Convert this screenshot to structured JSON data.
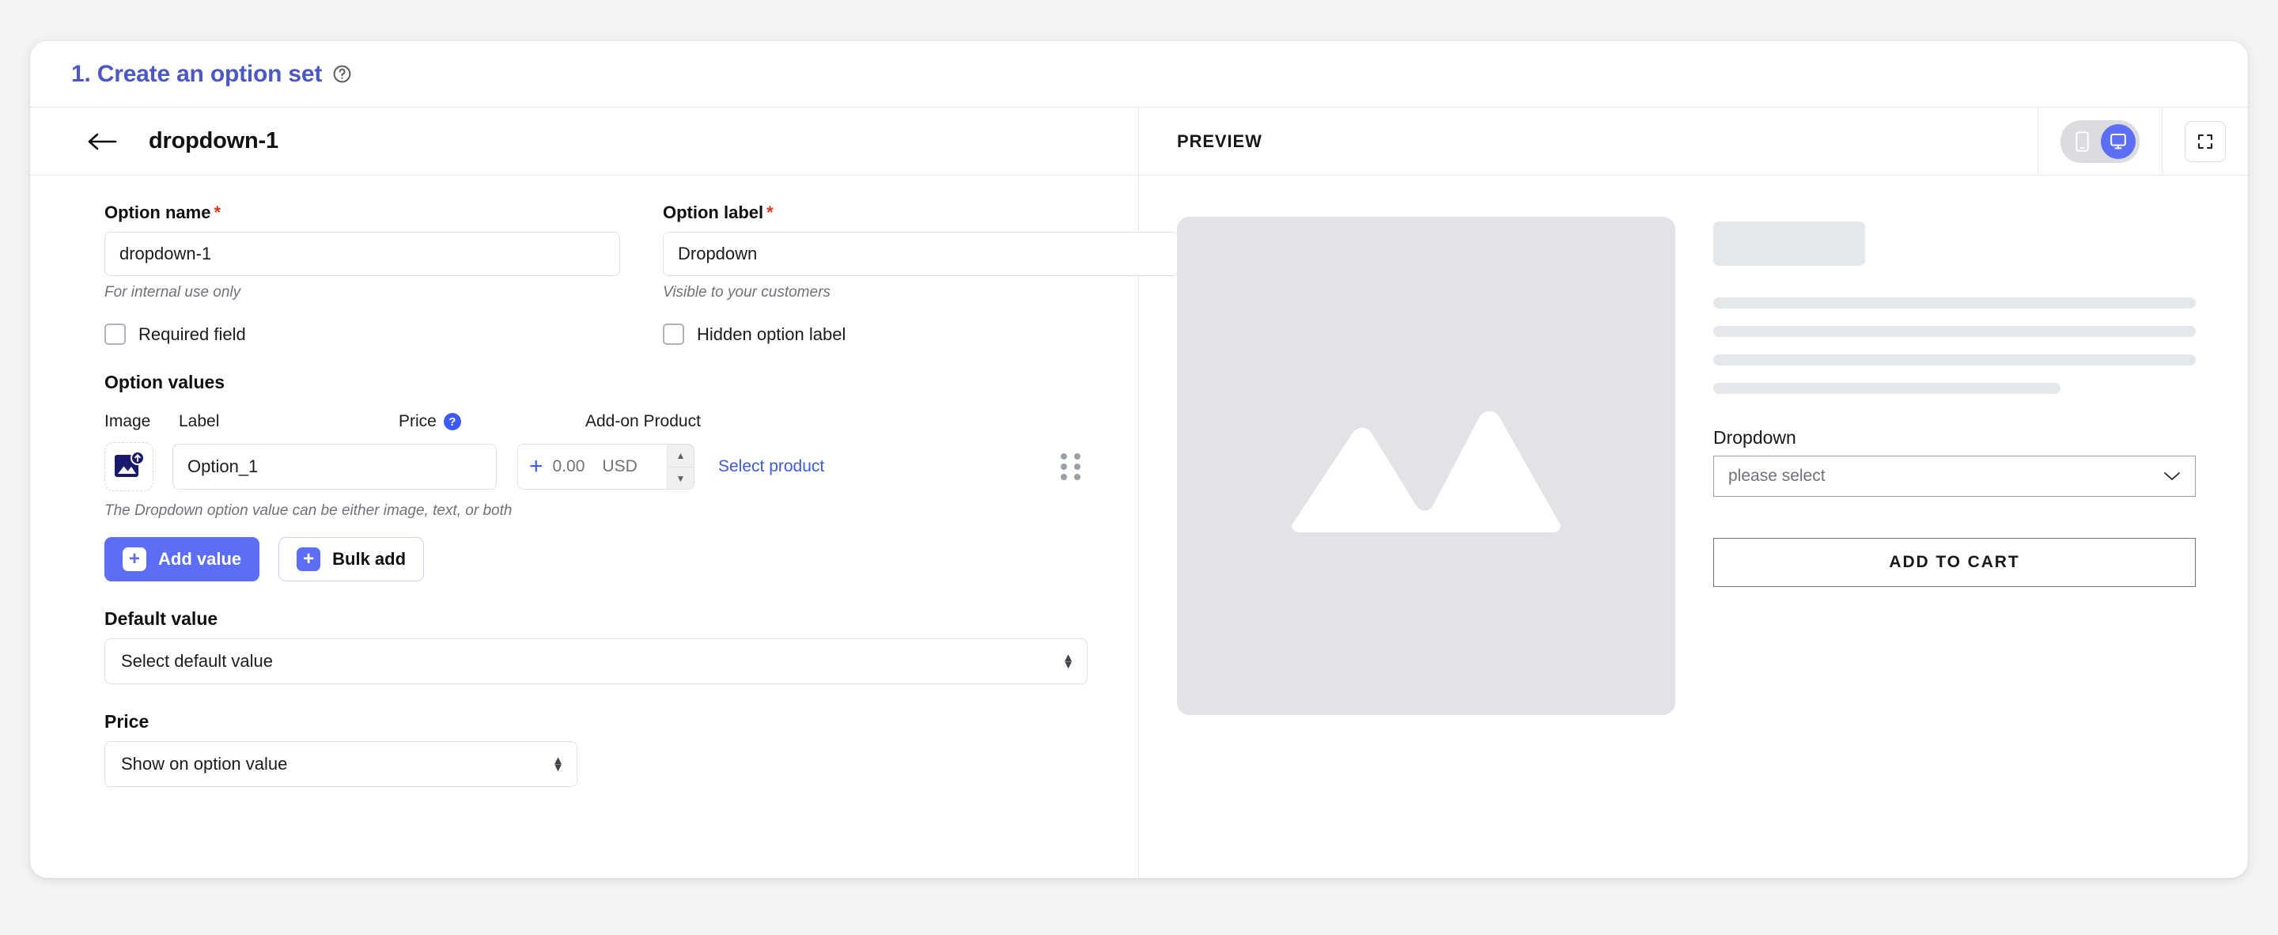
{
  "card": {
    "header_title": "1. Create an option set",
    "help_icon": "help-circle-icon"
  },
  "left": {
    "back_icon": "arrow-left-icon",
    "title": "dropdown-1",
    "option_name": {
      "label": "Option name",
      "required_mark": "*",
      "value": "dropdown-1",
      "hint": "For internal use only"
    },
    "option_label": {
      "label": "Option label",
      "required_mark": "*",
      "value": "Dropdown",
      "hint": "Visible to your customers"
    },
    "checkboxes": [
      {
        "label": "Required field",
        "checked": false
      },
      {
        "label": "Hidden option label",
        "checked": false
      }
    ],
    "option_values": {
      "section_title": "Option values",
      "columns": {
        "image": "Image",
        "label": "Label",
        "price": "Price",
        "price_help_icon": "question-badge-icon",
        "addon": "Add-on Product"
      },
      "rows": [
        {
          "image_icon": "image-upload-icon",
          "label_value": "Option_1",
          "price_plus": "+",
          "price_value": "0.00",
          "currency": "USD",
          "addon_link": "Select product",
          "drag_icon": "drag-handle-icon"
        }
      ],
      "hint": "The Dropdown option value can be either image, text, or both"
    },
    "buttons": {
      "add_value": "Add value",
      "bulk_add": "Bulk add",
      "plus_glyph": "+"
    },
    "default_value": {
      "label": "Default value",
      "selected": "Select default value"
    },
    "price_display": {
      "label": "Price",
      "selected": "Show on option value"
    }
  },
  "preview": {
    "title": "PREVIEW",
    "device_toggle": {
      "mobile_icon": "mobile-icon",
      "desktop_icon": "desktop-icon",
      "active": "desktop"
    },
    "expand_icon": "fullscreen-icon",
    "product_image_icon": "image-placeholder-icon",
    "dropdown_label": "Dropdown",
    "dropdown_placeholder": "please select",
    "dropdown_caret_icon": "chevron-down-icon",
    "add_to_cart": "ADD TO CART"
  },
  "colors": {
    "accent": "#4a57c4",
    "primary_button": "#5b6ef5",
    "link": "#3b5bdb",
    "required": "#de3618",
    "skeleton": "#e4e7eb",
    "image_placeholder": "#e1e3e6"
  }
}
